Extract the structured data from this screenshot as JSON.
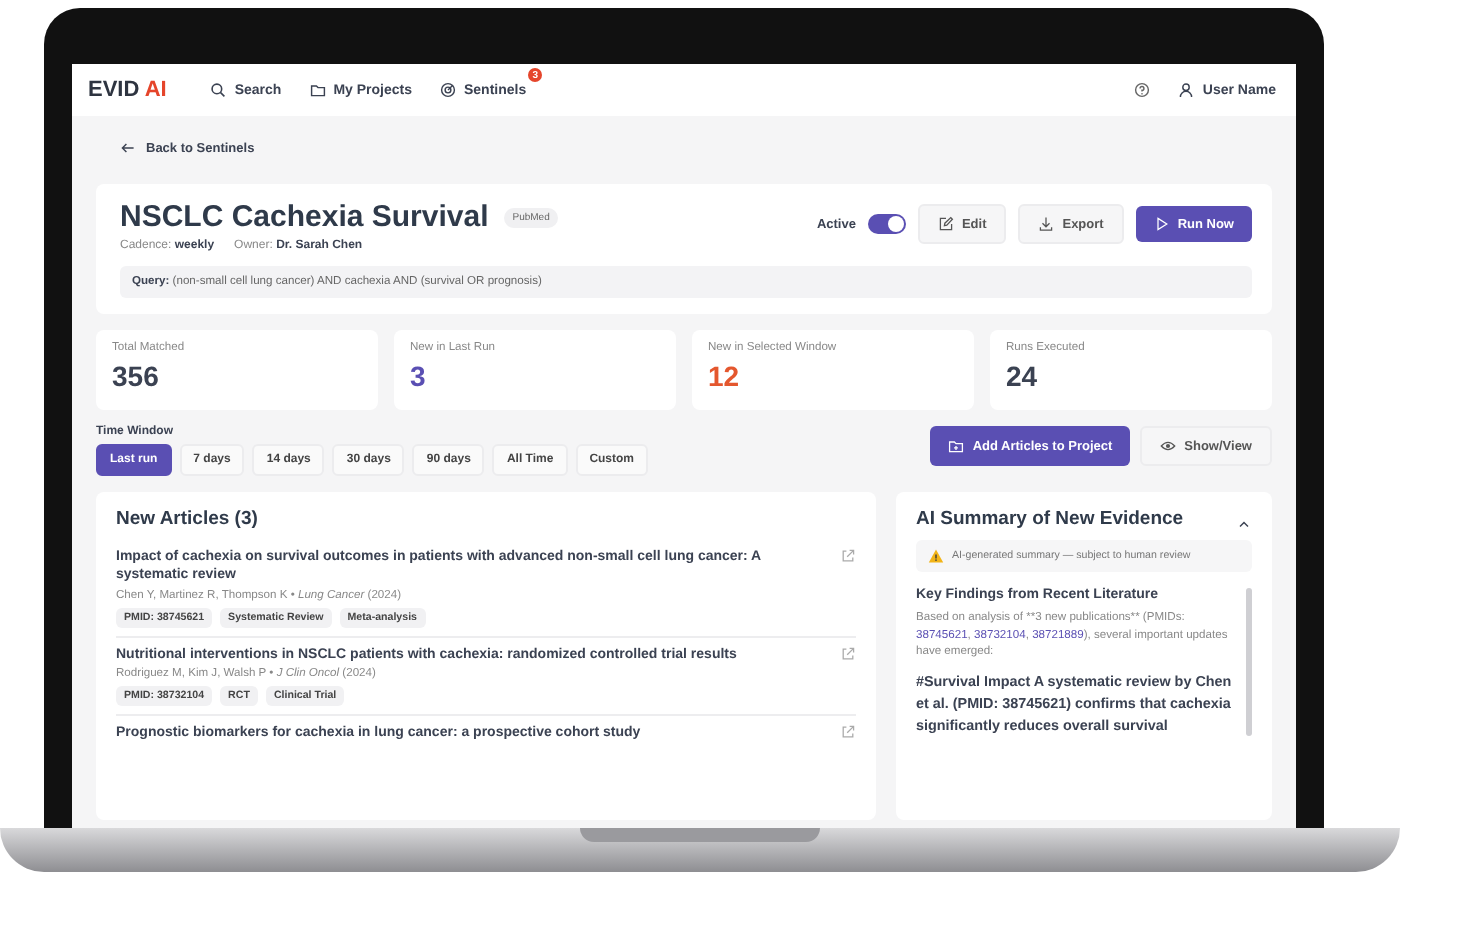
{
  "nav": {
    "logo": {
      "main": "EVID",
      "accent": "AI"
    },
    "links": [
      {
        "kind": "search",
        "label": "Search"
      },
      {
        "kind": "projects",
        "label": "My Projects"
      },
      {
        "kind": "sentinels",
        "label": "Sentinels",
        "badge": "3"
      }
    ],
    "user": "User Name"
  },
  "back_link": "Back to Sentinels",
  "sentinel": {
    "title": "NSCLC Cachexia Survival",
    "source_badge": "PubMed",
    "cadence_label": "Cadence:",
    "cadence": "weekly",
    "owner_label": "Owner:",
    "owner": "Dr. Sarah Chen",
    "query_label": "Query:",
    "query": "(non-small cell lung cancer) AND cachexia AND (survival OR prognosis)",
    "active_label": "Active",
    "active": true,
    "buttons": [
      {
        "kind": "edit",
        "label": "Edit"
      },
      {
        "kind": "export",
        "label": "Export"
      },
      {
        "kind": "run",
        "label": "Run Now"
      }
    ]
  },
  "stats": [
    {
      "label": "Total Matched",
      "value": "356",
      "color": "#3b4252"
    },
    {
      "label": "New in Last Run",
      "value": "3",
      "color": "#5a4fb3"
    },
    {
      "label": "New in Selected Window",
      "value": "12",
      "color": "#e4572e"
    },
    {
      "label": "Runs Executed",
      "value": "24",
      "color": "#3b4252"
    }
  ],
  "time_window": {
    "label": "Time Window",
    "options": [
      {
        "label": "Last run",
        "selected": true
      },
      {
        "label": "7 days",
        "selected": false
      },
      {
        "label": "14 days",
        "selected": false
      },
      {
        "label": "30 days",
        "selected": false
      },
      {
        "label": "90 days",
        "selected": false
      },
      {
        "label": "All Time",
        "selected": false
      },
      {
        "label": "Custom",
        "selected": false
      }
    ]
  },
  "actions": [
    {
      "kind": "add",
      "label": "Add Articles to Project"
    },
    {
      "kind": "show",
      "label": "Show/View"
    }
  ],
  "articles_panel": {
    "title": "New Articles (3)",
    "articles": [
      {
        "title": "Impact of cachexia on survival outcomes in patients with advanced non-small cell lung cancer: A systematic review",
        "byline": "Chen Y, Martinez R, Thompson K • *Lung Cancer* (2024)",
        "tags": [
          "PMID: 38745621",
          "Systematic Review",
          "Meta-analysis"
        ]
      },
      {
        "title": "Nutritional interventions in NSCLC patients with cachexia: randomized controlled trial results",
        "byline": "Rodriguez M, Kim J, Walsh P • *J Clin Oncol* (2024)",
        "tags": [
          "PMID: 38732104",
          "RCT",
          "Clinical Trial"
        ]
      },
      {
        "title": "Prognostic biomarkers for cachexia in lung cancer: a prospective cohort study"
      }
    ]
  },
  "summary_panel": {
    "title": "AI Summary of New Evidence",
    "notice": "AI-generated summary — subject to human review",
    "heading": "Key Findings from Recent Literature",
    "intro": [
      {
        "kind": "text",
        "text": "Based on analysis of **3 new publications** (PMIDs: "
      },
      {
        "kind": "link",
        "text": "38745621"
      },
      {
        "kind": "text",
        "text": ", "
      },
      {
        "kind": "link",
        "text": "38732104"
      },
      {
        "kind": "text",
        "text": ", "
      },
      {
        "kind": "link",
        "text": "38721889"
      },
      {
        "kind": "text",
        "text": "), several important updates have emerged:"
      }
    ],
    "finding": "#Survival Impact A systematic review by Chen et al. (PMID: 38745621) confirms that cachexia significantly reduces overall survival"
  }
}
